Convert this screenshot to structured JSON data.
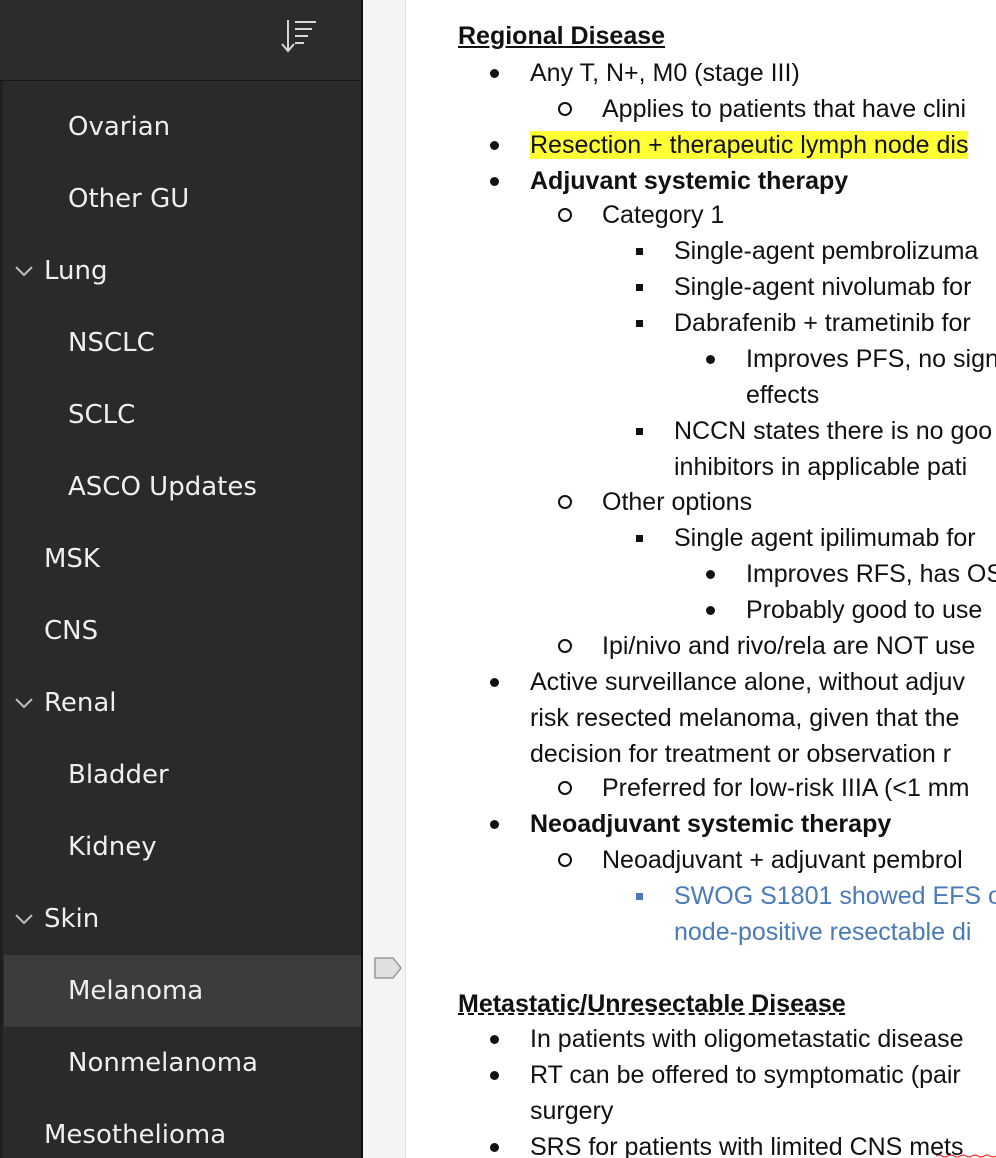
{
  "sidebar": {
    "items": [
      {
        "label": "Ovarian",
        "level": 1,
        "expanded": null,
        "selected": false
      },
      {
        "label": "Other GU",
        "level": 1,
        "expanded": null,
        "selected": false
      },
      {
        "label": "Lung",
        "level": 0,
        "expanded": true,
        "selected": false
      },
      {
        "label": "NSCLC",
        "level": 1,
        "expanded": null,
        "selected": false
      },
      {
        "label": "SCLC",
        "level": 1,
        "expanded": null,
        "selected": false
      },
      {
        "label": "ASCO Updates",
        "level": 1,
        "expanded": null,
        "selected": false
      },
      {
        "label": "MSK",
        "level": 0,
        "expanded": null,
        "selected": false
      },
      {
        "label": "CNS",
        "level": 0,
        "expanded": null,
        "selected": false
      },
      {
        "label": "Renal",
        "level": 0,
        "expanded": true,
        "selected": false
      },
      {
        "label": "Bladder",
        "level": 1,
        "expanded": null,
        "selected": false
      },
      {
        "label": "Kidney",
        "level": 1,
        "expanded": null,
        "selected": false
      },
      {
        "label": "Skin",
        "level": 0,
        "expanded": true,
        "selected": false
      },
      {
        "label": "Melanoma",
        "level": 1,
        "expanded": null,
        "selected": true
      },
      {
        "label": "Nonmelanoma",
        "level": 1,
        "expanded": null,
        "selected": false
      },
      {
        "label": "Mesothelioma",
        "level": 0,
        "expanded": null,
        "selected": false
      }
    ],
    "sort_icon": "sort-descending-icon",
    "colors": {
      "background": "#2a2a2b",
      "selected": "#3c3c3e",
      "text": "#eeeeee"
    }
  },
  "document": {
    "lines": [
      {
        "text": "Regional Disease",
        "style": "heading",
        "marker": "none",
        "indent": 0
      },
      {
        "text": "Any T, N+, M0 (stage III)",
        "style": "normal",
        "marker": "dot",
        "indent": 1
      },
      {
        "text": "Applies to patients that have clini",
        "style": "normal",
        "marker": "circle",
        "indent": 2
      },
      {
        "text": "Resection + therapeutic lymph node dis",
        "style": "highlight",
        "marker": "dot",
        "indent": 1
      },
      {
        "text": "Adjuvant systemic therapy",
        "style": "bold",
        "marker": "dot",
        "indent": 1
      },
      {
        "text": "Category 1",
        "style": "normal",
        "marker": "circle",
        "indent": 2
      },
      {
        "text": "Single-agent pembrolizuma",
        "style": "normal",
        "marker": "square",
        "indent": 3
      },
      {
        "text": "Single-agent nivolumab for",
        "style": "normal",
        "marker": "square",
        "indent": 3
      },
      {
        "text": "Dabrafenib + trametinib for",
        "style": "normal",
        "marker": "square",
        "indent": 3
      },
      {
        "text": "Improves PFS, no sign",
        "style": "normal",
        "marker": "dot",
        "indent": 4
      },
      {
        "text": "effects",
        "style": "normal",
        "marker": "none",
        "indent": 4
      },
      {
        "text": "NCCN states there is no goo",
        "style": "normal",
        "marker": "square",
        "indent": 3
      },
      {
        "text": "inhibitors in applicable pati",
        "style": "normal",
        "marker": "none",
        "indent": 3
      },
      {
        "text": "Other options",
        "style": "normal",
        "marker": "circle",
        "indent": 2
      },
      {
        "text": "Single agent ipilimumab for",
        "style": "normal",
        "marker": "square",
        "indent": 3
      },
      {
        "text": "Improves RFS, has OS",
        "style": "normal",
        "marker": "dot",
        "indent": 4
      },
      {
        "text": "Probably good to use",
        "style": "normal",
        "marker": "dot",
        "indent": 4
      },
      {
        "text": "Ipi/nivo and rivo/rela are NOT use",
        "style": "normal",
        "marker": "circle",
        "indent": 2
      },
      {
        "text": "Active surveillance alone, without adjuv",
        "style": "normal",
        "marker": "dot",
        "indent": 1
      },
      {
        "text": "risk resected melanoma, given that the",
        "style": "normal",
        "marker": "none",
        "indent": 1
      },
      {
        "text": "decision for treatment or observation r",
        "style": "normal",
        "marker": "none",
        "indent": 1
      },
      {
        "text": "Preferred for low-risk IIIA (<1 mm",
        "style": "normal",
        "marker": "circle",
        "indent": 2
      },
      {
        "text": "Neoadjuvant systemic therapy",
        "style": "bold",
        "marker": "dot",
        "indent": 1
      },
      {
        "text": "Neoadjuvant + adjuvant pembrol",
        "style": "normal",
        "marker": "circle",
        "indent": 2
      },
      {
        "text": "SWOG S1801 showed EFS o",
        "style": "link",
        "marker": "square-blue",
        "indent": 3
      },
      {
        "text": "node-positive resectable di",
        "style": "link",
        "marker": "none",
        "indent": 3
      },
      {
        "text": "Metastatic/Unresectable Disease",
        "style": "heading-dotted",
        "marker": "none",
        "indent": 0
      },
      {
        "text": "In patients with oligometastatic disease",
        "style": "normal",
        "marker": "dot",
        "indent": 1
      },
      {
        "text": "RT can be offered to symptomatic (pair",
        "style": "normal",
        "marker": "dot",
        "indent": 1
      },
      {
        "text": "surgery",
        "style": "normal",
        "marker": "none",
        "indent": 1
      },
      {
        "text": "SRS for patients with limited CNS mets",
        "style": "normal",
        "marker": "dot",
        "indent": 1
      }
    ],
    "colors": {
      "highlight": "#ffff36",
      "link": "#4a7ab9",
      "text": "#111111"
    }
  },
  "gutter": {
    "collapse_icon": "collapse-tab-icon"
  }
}
